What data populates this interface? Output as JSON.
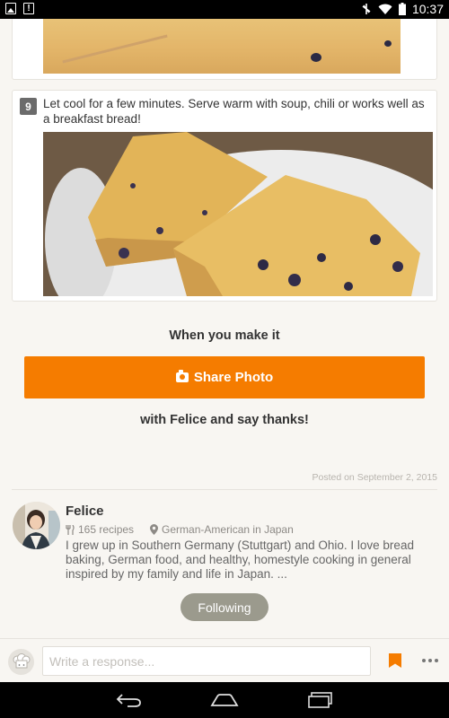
{
  "status_bar": {
    "time": "10:37",
    "icons": [
      "gallery-notification-icon",
      "alert-notification-icon",
      "mute-icon",
      "wifi-icon",
      "battery-icon"
    ]
  },
  "step": {
    "number": "9",
    "text": "Let cool for a few minutes. Serve warm with soup, chili or works well as a breakfast bread!"
  },
  "cta": {
    "make_label": "When you make it",
    "share_button": "Share Photo",
    "thanks_label": "with Felice and say thanks!"
  },
  "posted": "Posted on September 2, 2015",
  "author": {
    "name": "Felice",
    "recipes": "165 recipes",
    "location": "German-American in Japan",
    "bio": "I grew up in Southern Germany (Stuttgart) and Ohio. I love bread baking, German food, and healthy, homestyle cooking in general inspired by my family and life in Japan. ...",
    "follow_button": "Following"
  },
  "response": {
    "placeholder": "Write a response..."
  },
  "colors": {
    "accent": "#f57c00",
    "following_bg": "#9b9a8d",
    "background": "#f8f6f2"
  }
}
